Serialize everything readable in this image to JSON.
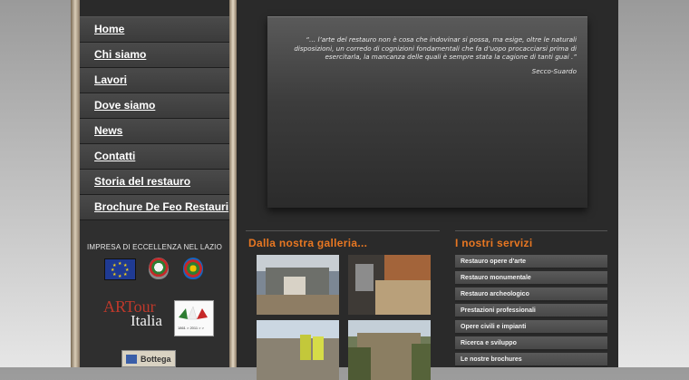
{
  "nav": {
    "items": [
      {
        "label": "Home"
      },
      {
        "label": "Chi siamo"
      },
      {
        "label": "Lavori"
      },
      {
        "label": "Dove siamo"
      },
      {
        "label": "News"
      },
      {
        "label": "Contatti"
      },
      {
        "label": "Storia del restauro"
      },
      {
        "label": "Brochure De Feo Restauri"
      }
    ]
  },
  "sidebar": {
    "impresa_label": "IMPRESA DI ECCELLENZA NEL LAZIO",
    "artour": {
      "line1": "ARTour",
      "line2": "Italia",
      "dates": "1861 > 2011 > >"
    },
    "bottega_label": "Bottega"
  },
  "quote": {
    "text": "“… l’arte del restauro non è cosa che indovinar si possa, ma esige, oltre le naturali disposizioni, un corredo di cognizioni fondamentali che fa d’uopo procacciarsi prima di esercitarla, la mancanza delle quali è sempre stata la cagione di tanti guai .”",
    "author": "Secco-Suardo"
  },
  "gallery": {
    "title": "Dalla nostra galleria..."
  },
  "services": {
    "title": "I nostri servizi",
    "items": [
      {
        "label": "Restauro opere d'arte"
      },
      {
        "label": "Restauro monumentale"
      },
      {
        "label": "Restauro archeologico"
      },
      {
        "label": "Prestazioni professionali"
      },
      {
        "label": "Opere civili e impianti"
      },
      {
        "label": "Ricerca e sviluppo"
      },
      {
        "label": "Le nostre brochures"
      }
    ]
  },
  "colors": {
    "accent_orange": "#e87722",
    "background": "#2a2a2a",
    "gold": "#d9ccb7"
  }
}
